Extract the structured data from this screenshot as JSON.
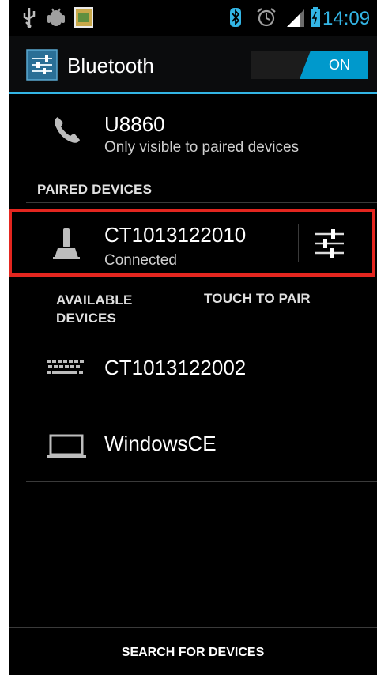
{
  "status_bar": {
    "time": "14:09",
    "icons": [
      "usb-icon",
      "android-debug-icon",
      "app-notification-icon",
      "bluetooth-icon",
      "alarm-icon",
      "signal-icon",
      "battery-icon"
    ],
    "accent_color": "#33b5e5"
  },
  "action_bar": {
    "title": "Bluetooth",
    "toggle_label": "ON",
    "toggle_color": "#0099cc"
  },
  "this_device": {
    "name": "U8860",
    "visibility": "Only visible to paired devices"
  },
  "paired": {
    "header": "PAIRED DEVICES",
    "devices": [
      {
        "name": "CT1013122010",
        "status": "Connected",
        "icon": "device-icon"
      }
    ],
    "highlight_color": "#e3261f"
  },
  "available": {
    "header": "AVAILABLE DEVICES",
    "hint": "TOUCH TO PAIR",
    "devices": [
      {
        "name": "CT1013122002",
        "icon": "keyboard-icon"
      },
      {
        "name": "WindowsCE",
        "icon": "laptop-icon"
      }
    ]
  },
  "bottom_bar": {
    "search_label": "SEARCH FOR DEVICES"
  }
}
